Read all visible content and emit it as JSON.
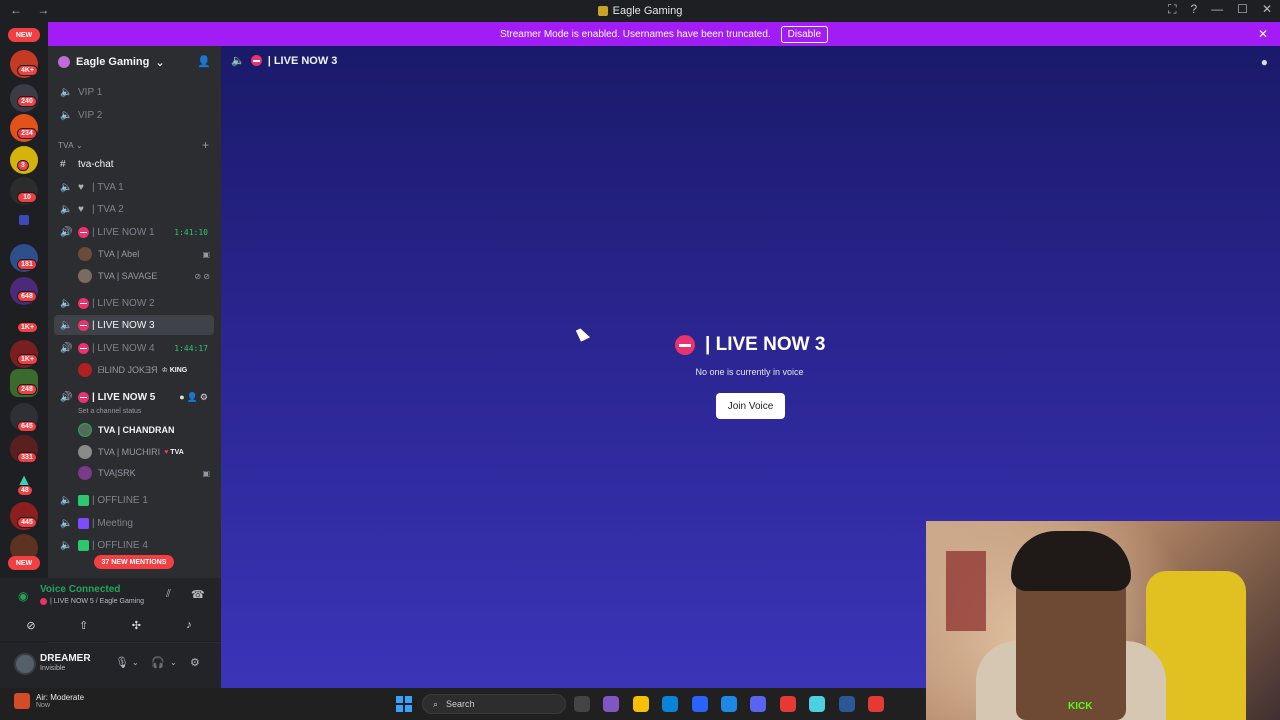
{
  "window": {
    "title": "Eagle Gaming",
    "nav": "← →",
    "controls": [
      "⛶",
      "?",
      "—",
      "☐",
      "✕"
    ]
  },
  "banner": {
    "text": "Streamer Mode is enabled. Usernames have been truncated.",
    "button": "Disable"
  },
  "server_rail": {
    "top_badge": "NEW",
    "bottom_badge": "NEW",
    "badges": [
      "4K+",
      "240",
      "234",
      "3",
      "10",
      "181",
      "648",
      "1K+",
      "1K+",
      "248",
      "645",
      "331",
      "48",
      "445"
    ]
  },
  "server": {
    "name": "Eagle Gaming",
    "chevron": "⌄"
  },
  "channels_top": [
    {
      "name": "VIP 1"
    },
    {
      "name": "VIP 2"
    }
  ],
  "category": {
    "name": "TVA",
    "chevron": "⌄",
    "add": "+"
  },
  "text_channel": {
    "name": "tva-chat"
  },
  "channels": {
    "tva1": "| TVA 1",
    "tva2": "| TVA 2",
    "live1": "| LIVE NOW 1",
    "live1_timer": "1:41:10",
    "live2": "| LIVE NOW 2",
    "live3": "| LIVE NOW 3",
    "live4": "| LIVE NOW 4",
    "live4_timer": "1:44:17",
    "live5": "| LIVE NOW 5",
    "live5_status": "Set a channel status",
    "offline1": "| OFFLINE 1",
    "meeting": "| Meeting",
    "offline4": "| OFFLINE 4"
  },
  "users": {
    "abel": "TVA | Abel",
    "savage": "TVA | SAVAGE",
    "blind": "ᗷLIND JOKƎЯ",
    "blind_tag": "KING",
    "chandran": "TVA | CHANDRAN",
    "muchiri": "TVA | MUCHIRI",
    "muchiri_tag": "TVA",
    "srk": "TVA|SRK"
  },
  "mentions": "37 NEW MENTIONS",
  "voice": {
    "status": "Voice Connected",
    "location": "| LIVE NOW 5 / Eagle Gaming"
  },
  "user_panel": {
    "name": "DREAMER",
    "status": "Invisible"
  },
  "main": {
    "header": "| LIVE NOW 3",
    "title": "| LIVE NOW 3",
    "subtitle": "No one is currently in voice",
    "join_button": "Join Voice"
  },
  "webcam": {
    "logo_text": "KICK"
  },
  "taskbar": {
    "weather_title": "Air: Moderate",
    "weather_sub": "Now",
    "search_placeholder": "Search",
    "app_colors": [
      "#444444",
      "#7e57c2",
      "#f6c000",
      "#0a84d6",
      "#2962ff",
      "#1e88e5",
      "#5865f2",
      "#e53935",
      "#4dd0e1",
      "#2b5797",
      "#e53935"
    ]
  },
  "colors": {
    "accent_banner": "#a21cf5",
    "voice_green": "#23a55a",
    "live_red": "#e8336d",
    "badge_red": "#f23f43"
  }
}
